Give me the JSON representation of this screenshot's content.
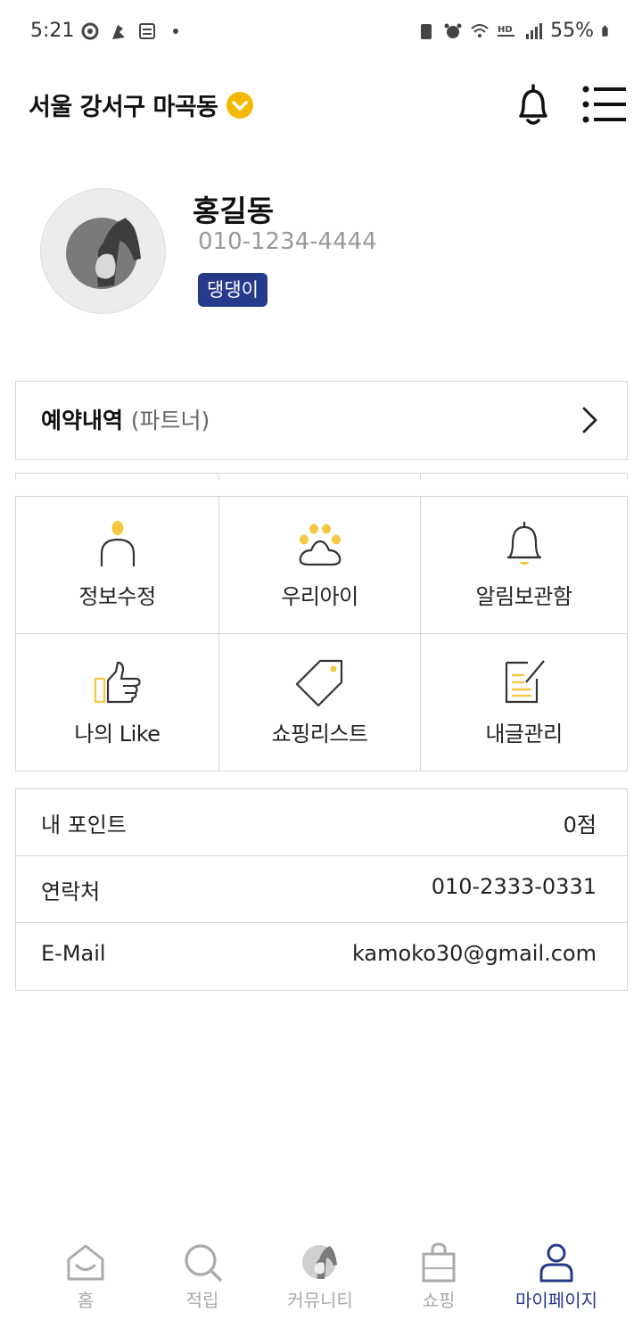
{
  "status_bar": {
    "time": "5:21",
    "battery": "55%"
  },
  "header": {
    "location": "서울 강서구 마곡동",
    "icons": [
      "chevron-down-circle-icon",
      "bell-icon",
      "menu-icon"
    ],
    "accent_color": "#f5b800"
  },
  "profile": {
    "name": "홍길동",
    "phone": "010-1234-4444",
    "badge": "댕댕이",
    "badge_color": "#263a8c"
  },
  "reservation": {
    "title": "예약내역",
    "subtitle": "(파트너)"
  },
  "menu": [
    {
      "label": "정보수정",
      "icon": "user-icon"
    },
    {
      "label": "우리아이",
      "icon": "paw-icon"
    },
    {
      "label": "알림보관함",
      "icon": "bell-icon"
    },
    {
      "label": "나의 Like",
      "icon": "thumbs-up-icon"
    },
    {
      "label": "쇼핑리스트",
      "icon": "tag-icon"
    },
    {
      "label": "내글관리",
      "icon": "document-edit-icon"
    }
  ],
  "info": [
    {
      "label": "내 포인트",
      "value": "0점"
    },
    {
      "label": "연락처",
      "value": "010-2333-0331"
    },
    {
      "label": "E-Mail",
      "value": "kamoko30@gmail.com"
    }
  ],
  "bottom_nav": [
    {
      "label": "홈",
      "icon": "home-icon"
    },
    {
      "label": "적립",
      "icon": "search-icon"
    },
    {
      "label": "커뮤니티",
      "icon": "pet-community-icon"
    },
    {
      "label": "쇼핑",
      "icon": "shopping-bag-icon"
    },
    {
      "label": "마이페이지",
      "icon": "user-icon",
      "active": true
    }
  ]
}
